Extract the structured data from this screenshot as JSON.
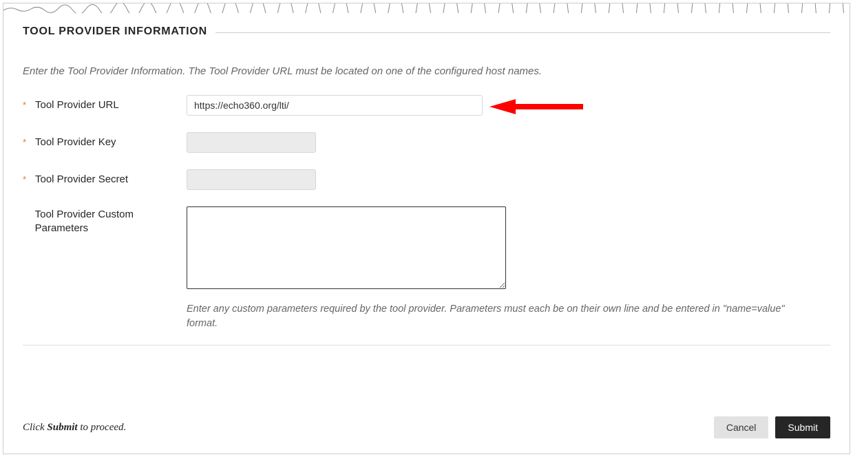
{
  "section_title": "TOOL PROVIDER INFORMATION",
  "instruction_text": "Enter the Tool Provider Information. The Tool Provider URL must be located on one of the configured host names.",
  "fields": {
    "url": {
      "label": "Tool Provider URL",
      "value": "https://echo360.org/lti/"
    },
    "key": {
      "label": "Tool Provider Key",
      "value": ""
    },
    "secret": {
      "label": "Tool Provider Secret",
      "value": ""
    },
    "custom": {
      "label": "Tool Provider Custom Parameters",
      "value": "",
      "hint": "Enter any custom parameters required by the tool provider. Parameters must each be on their own line and be entered in \"name=value\" format."
    }
  },
  "footer": {
    "prefix": "Click ",
    "bold": "Submit",
    "suffix": " to proceed."
  },
  "buttons": {
    "cancel": "Cancel",
    "submit": "Submit"
  }
}
